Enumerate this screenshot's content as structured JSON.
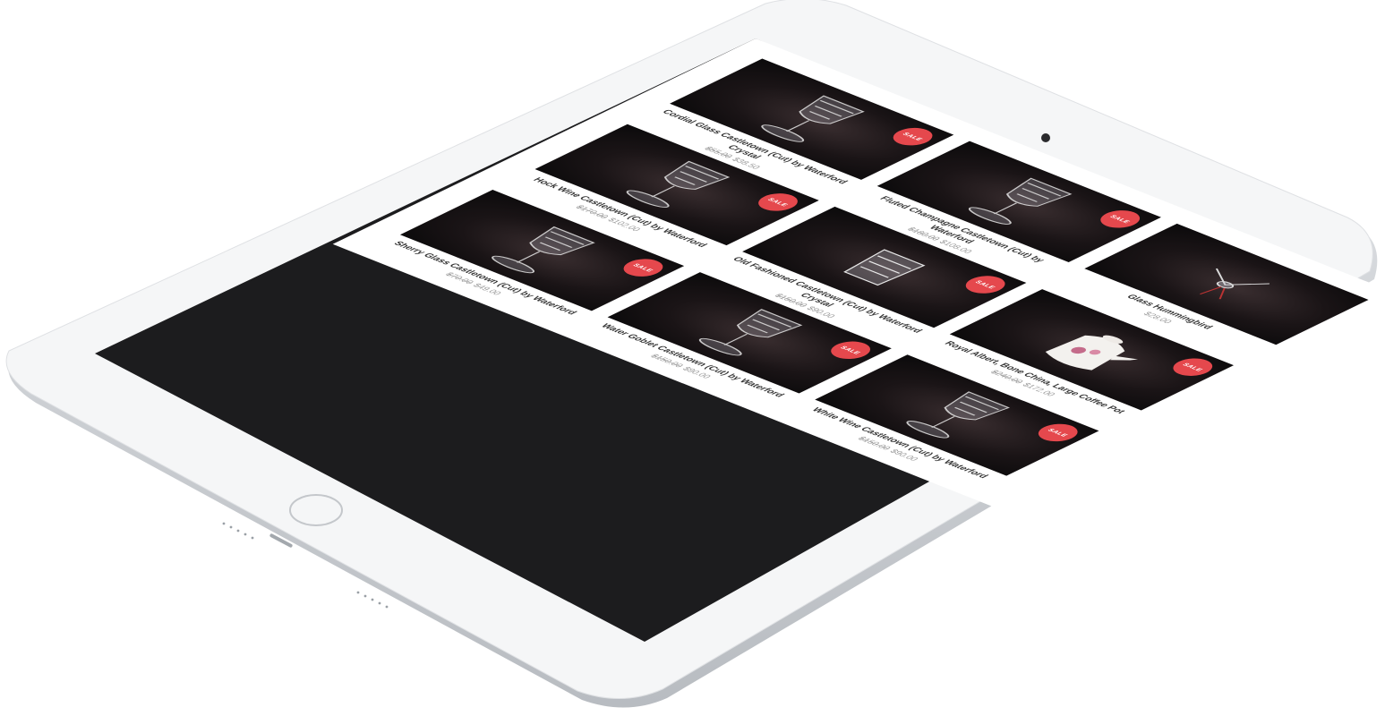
{
  "shop": {
    "sale_badge": "SALE",
    "products": [
      {
        "title": "Cordial Glass Castletown (Cut) by Waterford Crystal",
        "old_price": "$55.00",
        "price": "$38.50",
        "sale": true,
        "image_icon": "crystal-glass-icon"
      },
      {
        "title": "Fluted Champagne Castletown (Cut) by Waterford",
        "old_price": "$180.00",
        "price": "$108.00",
        "sale": true,
        "image_icon": "crystal-glass-icon"
      },
      {
        "title": "Glass Hummingbird",
        "old_price": "",
        "price": "$28.00",
        "sale": false,
        "image_icon": "hummingbird-icon"
      },
      {
        "title": "Hock Wine Castletown (Cut) by Waterford",
        "old_price": "$170.00",
        "price": "$102.00",
        "sale": true,
        "image_icon": "crystal-glass-icon"
      },
      {
        "title": "Old Fashioned Castletown (Cut) by Waterford Crystal",
        "old_price": "$150.00",
        "price": "$90.00",
        "sale": true,
        "image_icon": "crystal-tumbler-icon"
      },
      {
        "title": "Royal Albert, Bone China, Large Coffee Pot",
        "old_price": "$240.00",
        "price": "$172.00",
        "sale": true,
        "image_icon": "coffee-pot-icon"
      },
      {
        "title": "Sherry Glass Castletown (Cut) by Waterford",
        "old_price": "$70.00",
        "price": "$49.00",
        "sale": true,
        "image_icon": "crystal-glass-icon"
      },
      {
        "title": "Water Goblet Castletown (Cut) by Waterford",
        "old_price": "$150.00",
        "price": "$90.00",
        "sale": true,
        "image_icon": "crystal-glass-icon"
      },
      {
        "title": "White Wine Castletown (Cut) by Waterford",
        "old_price": "$150.00",
        "price": "$90.00",
        "sale": true,
        "image_icon": "crystal-glass-icon"
      }
    ]
  },
  "colors": {
    "sale_badge": "#e5484d",
    "frame": "#f5f6f7",
    "bezel_edge": "#c9ccd0"
  }
}
